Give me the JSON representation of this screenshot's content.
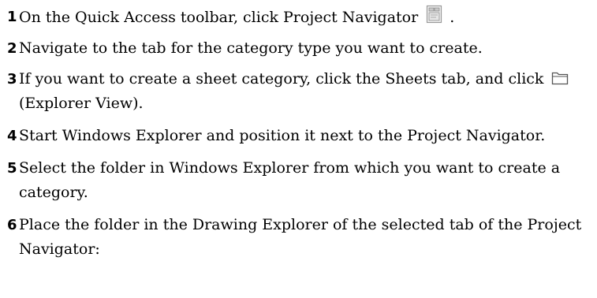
{
  "steps": [
    {
      "number": "1",
      "text_before": "On the Quick Access toolbar, click Project Navigator",
      "icon": "project-navigator-icon",
      "text_after": "."
    },
    {
      "number": "2",
      "text": "Navigate to the tab for the category type you want to create."
    },
    {
      "number": "3",
      "text_before": "If you want to create a sheet category, click the Sheets tab, and click",
      "icon": "explorer-view-icon",
      "text_after": "(Explorer View)."
    },
    {
      "number": "4",
      "text": "Start Windows Explorer and position it next to the Project Navigator."
    },
    {
      "number": "5",
      "text": "Select the folder in Windows Explorer from which you want to create a category."
    },
    {
      "number": "6",
      "text": "Place the folder in the Drawing Explorer of the selected tab of the Project Navigator:"
    }
  ]
}
